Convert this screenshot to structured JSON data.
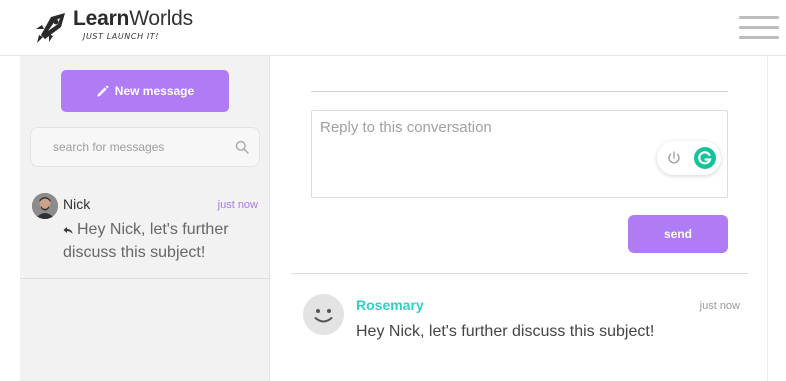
{
  "header": {
    "logo_bold": "Learn",
    "logo_rest": "Worlds",
    "tagline": "JUST LAUNCH IT!",
    "menu_icon": "hamburger-icon"
  },
  "sidebar": {
    "new_message_label": "New message",
    "new_message_icon": "pencil-icon",
    "search_placeholder": "search for messages",
    "search_icon": "search-icon",
    "conversations": [
      {
        "name": "Nick",
        "time": "just now",
        "preview": "Hey Nick, let's further discuss this subject!",
        "preview_icon": "reply-icon"
      }
    ]
  },
  "main": {
    "reply_placeholder": "Reply to this conversation",
    "send_label": "send",
    "messages": [
      {
        "author": "Rosemary",
        "time": "just now",
        "text": "Hey Nick, let's further discuss this subject!",
        "avatar_icon": "smiley-avatar-icon"
      }
    ]
  },
  "colors": {
    "accent": "#b07cf5",
    "author_name": "#2fd0c6",
    "grammarly": "#15c39a",
    "sidebar_bg": "#f2f2f2"
  }
}
